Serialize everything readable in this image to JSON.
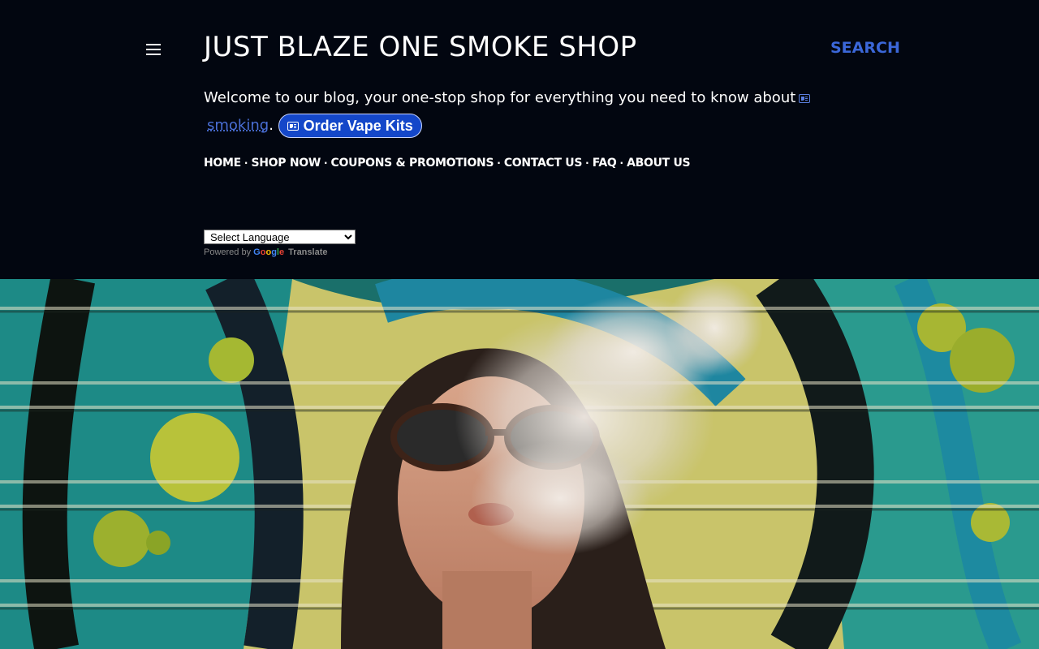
{
  "header": {
    "site_title": "JUST BLAZE ONE SMOKE SHOP",
    "search_label": "SEARCH",
    "description_text": "Welcome to our blog, your one-stop shop for everything you need to know about",
    "description_link": "smoking",
    "description_period": ".",
    "order_button_label": "Order Vape Kits"
  },
  "nav": {
    "items": [
      "HOME",
      "SHOP NOW",
      "COUPONS & PROMOTIONS",
      "CONTACT US",
      "FAQ",
      "ABOUT US"
    ],
    "separator": "·"
  },
  "translate": {
    "select_value": "Select Language",
    "powered_by": "Powered by",
    "google": "Google",
    "translate_label": "Translate"
  },
  "hero": {
    "subject": "woman in sunglasses exhaling vapor in front of graffiti-painted rolling shutter"
  },
  "colors": {
    "background": "#020610",
    "accent_link": "#3b67d8",
    "order_button": "#1447c9"
  },
  "icons": [
    "menu-icon",
    "news-icon"
  ]
}
